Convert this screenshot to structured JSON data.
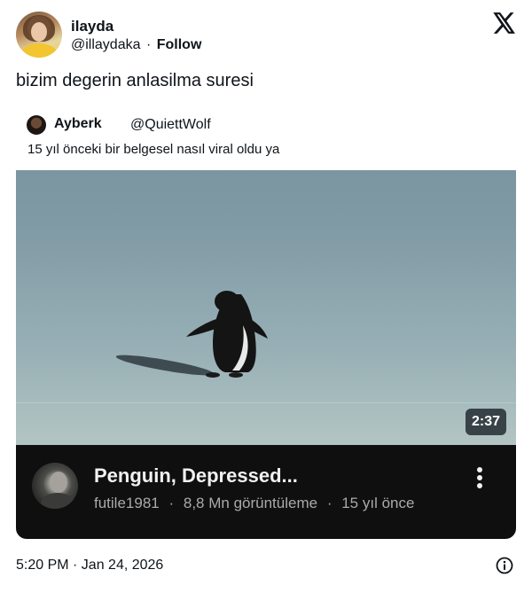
{
  "author": {
    "display_name": "ilayda",
    "handle": "@illaydaka",
    "separator": "·",
    "follow_label": "Follow",
    "avatar_icon": "user-avatar"
  },
  "brand": {
    "logo_icon": "x-logo-icon"
  },
  "tweet": {
    "text": "bizim degerin anlasilma suresi",
    "timestamp": "5:20 PM · Jan 24, 2026",
    "info_icon": "info-icon"
  },
  "quoted": {
    "display_name": "Ayberk",
    "handle": "@QuiettWolf",
    "text": "15 yıl önceki bir belgesel nasıl viral oldu ya",
    "avatar_icon": "user-avatar"
  },
  "video": {
    "duration": "2:37",
    "title": "Penguin, Depressed...",
    "channel": "futile1981",
    "views": "8,8 Mn görüntüleme",
    "age": "15 yıl önce",
    "dot": "·",
    "more_icon": "more-vertical-icon"
  },
  "colors": {
    "text": "#0f1419",
    "info_bar_bg": "#0f0f0f",
    "video_title": "#f1f1f1",
    "video_meta": "#aaaaaa"
  }
}
